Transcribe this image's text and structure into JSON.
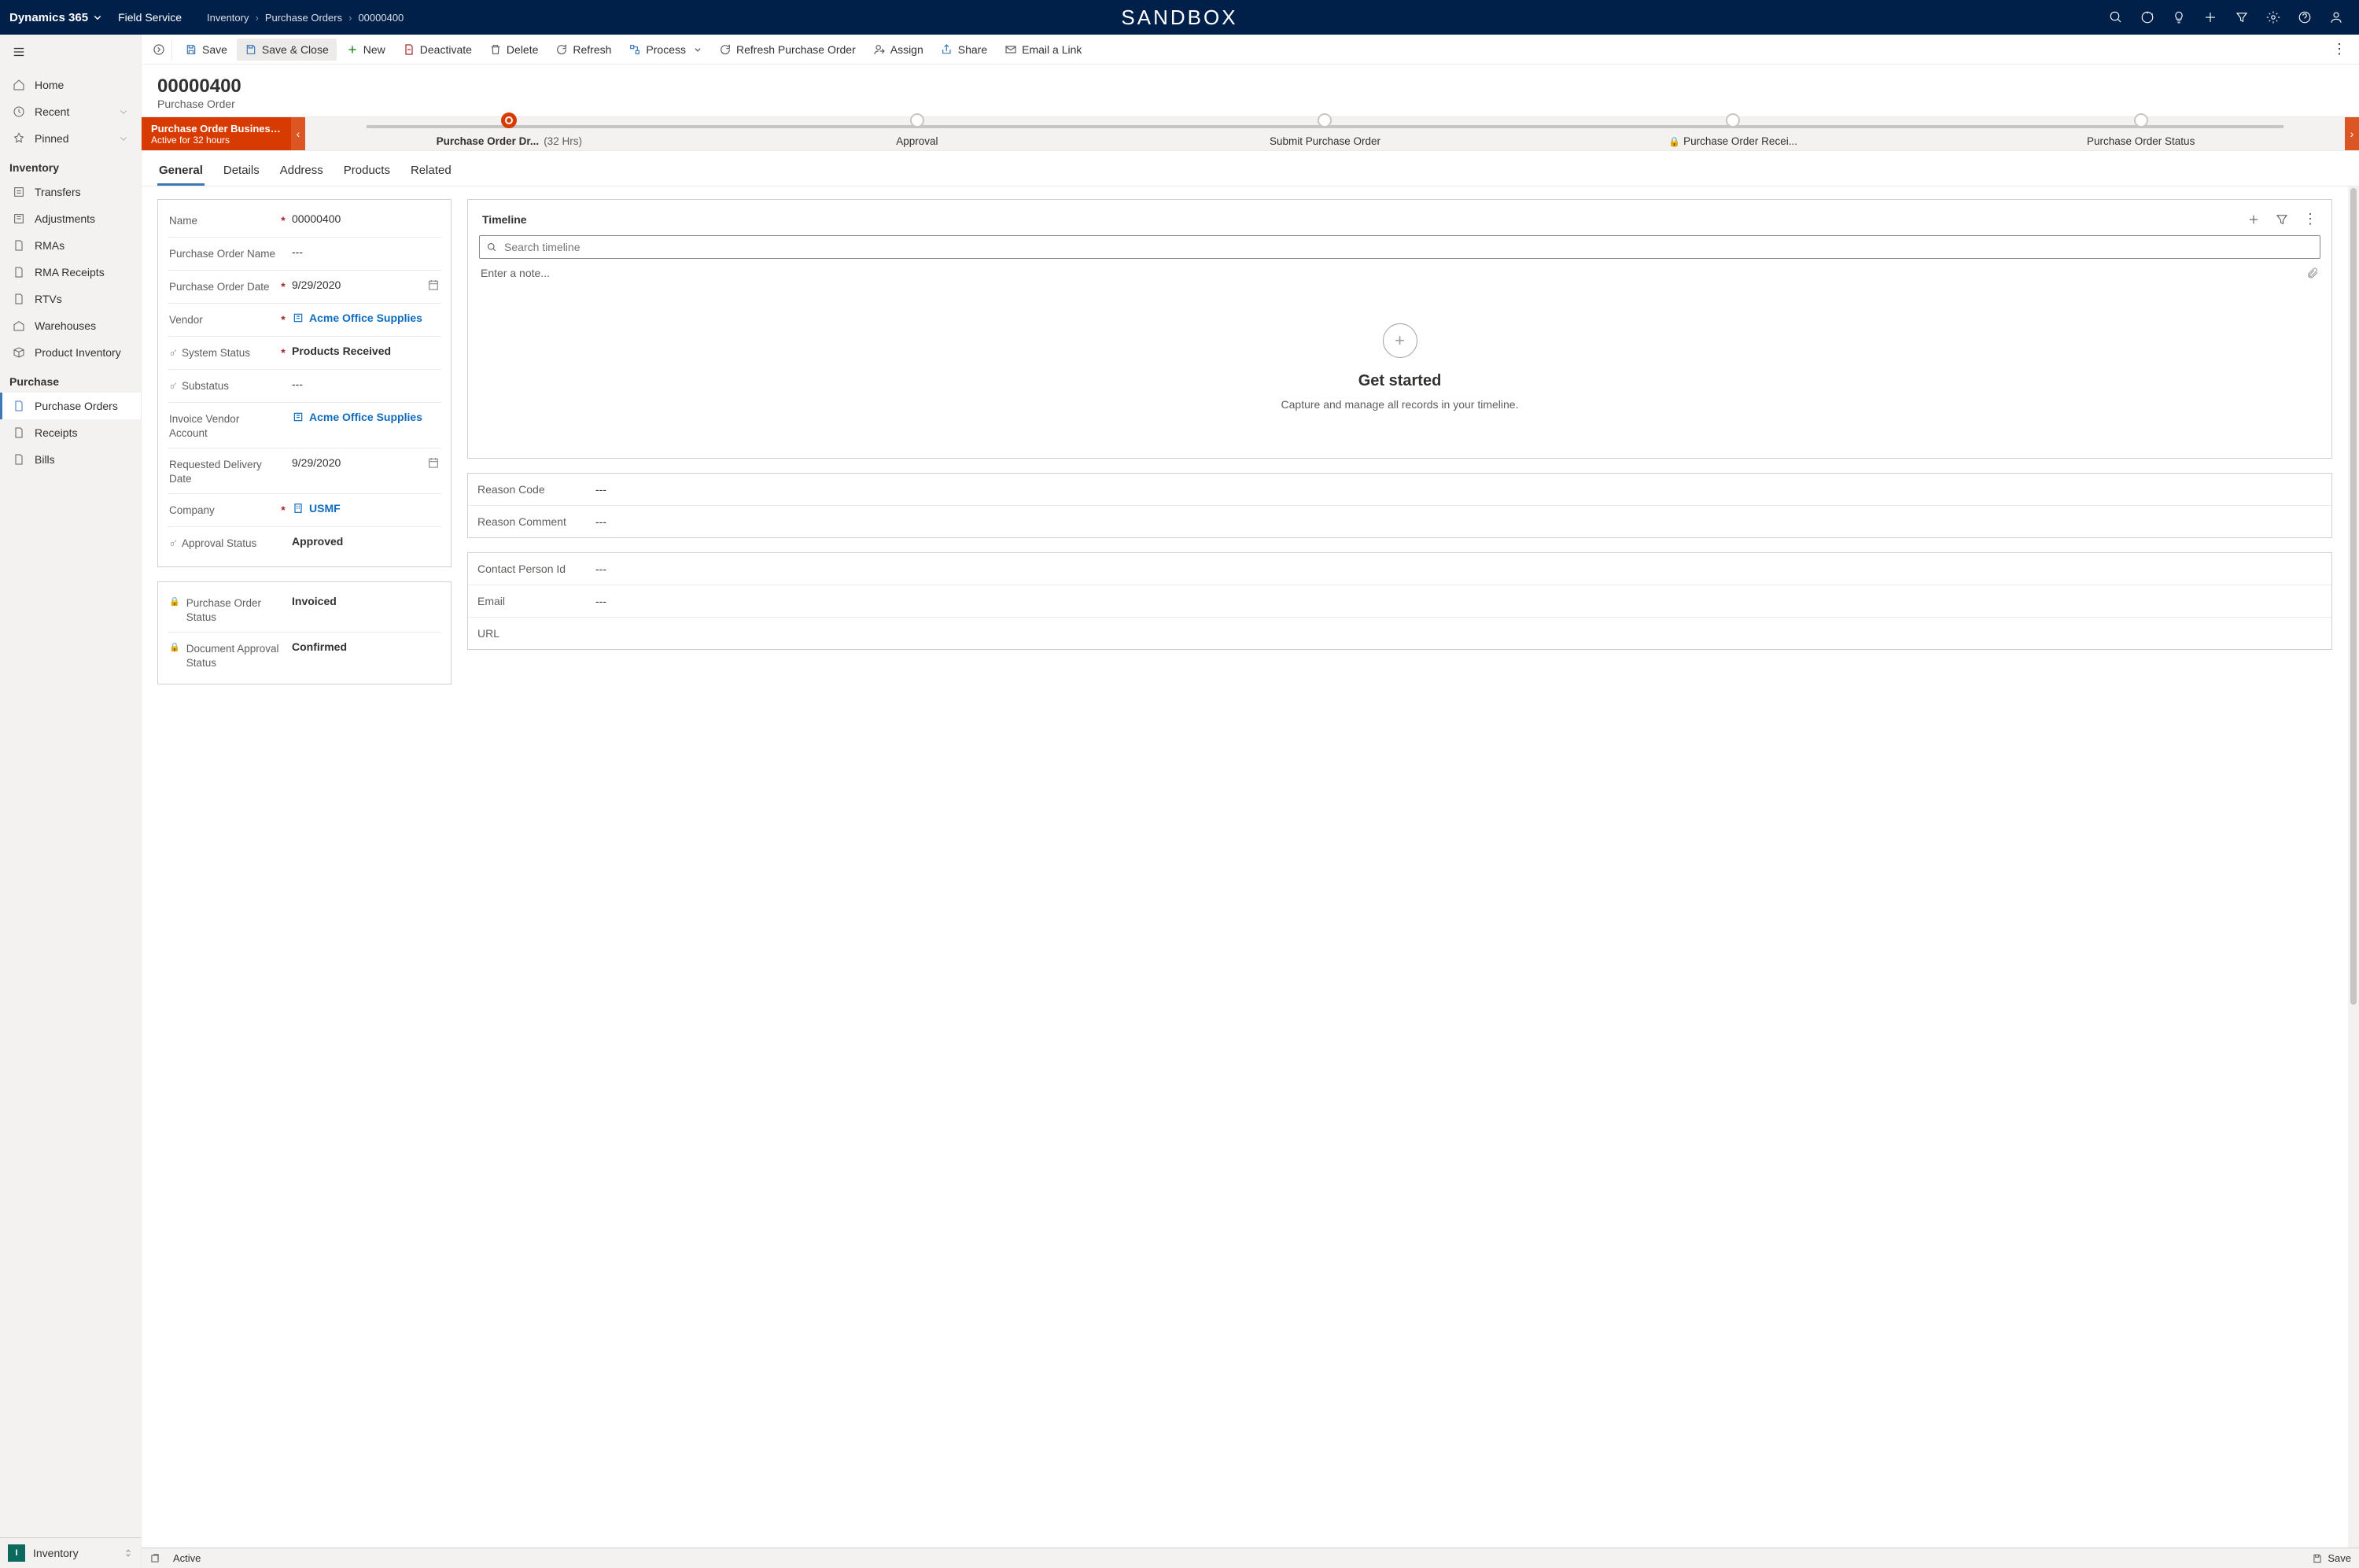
{
  "topbar": {
    "app_name": "Dynamics 365",
    "app_area": "Field Service",
    "breadcrumb": [
      "Inventory",
      "Purchase Orders",
      "00000400"
    ],
    "env_label": "SANDBOX"
  },
  "sidebar": {
    "nav_home": "Home",
    "nav_recent": "Recent",
    "nav_pinned": "Pinned",
    "section_inventory": "Inventory",
    "nav_transfers": "Transfers",
    "nav_adjustments": "Adjustments",
    "nav_rmas": "RMAs",
    "nav_rma_receipts": "RMA Receipts",
    "nav_rtvs": "RTVs",
    "nav_warehouses": "Warehouses",
    "nav_product_inventory": "Product Inventory",
    "section_purchase": "Purchase",
    "nav_purchase_orders": "Purchase Orders",
    "nav_receipts": "Receipts",
    "nav_bills": "Bills",
    "footer_badge": "I",
    "footer_label": "Inventory"
  },
  "commands": {
    "save": "Save",
    "save_close": "Save & Close",
    "new": "New",
    "deactivate": "Deactivate",
    "delete": "Delete",
    "refresh": "Refresh",
    "process": "Process",
    "refresh_po": "Refresh Purchase Order",
    "assign": "Assign",
    "share": "Share",
    "email_link": "Email a Link"
  },
  "record": {
    "title": "00000400",
    "subtitle": "Purchase Order"
  },
  "bpf": {
    "name": "Purchase Order Business ...",
    "duration": "Active for 32 hours",
    "stages": [
      {
        "label": "Purchase Order Dr...",
        "dur": "(32 Hrs)"
      },
      {
        "label": "Approval"
      },
      {
        "label": "Submit Purchase Order"
      },
      {
        "label": "Purchase Order Recei...",
        "locked": true
      },
      {
        "label": "Purchase Order Status"
      }
    ]
  },
  "tabs": [
    "General",
    "Details",
    "Address",
    "Products",
    "Related"
  ],
  "form": {
    "name_lbl": "Name",
    "name_val": "00000400",
    "po_name_lbl": "Purchase Order Name",
    "po_name_val": "---",
    "po_date_lbl": "Purchase Order Date",
    "po_date_val": "9/29/2020",
    "vendor_lbl": "Vendor",
    "vendor_val": "Acme Office Supplies",
    "sysstatus_lbl": "System Status",
    "sysstatus_val": "Products Received",
    "substatus_lbl": "Substatus",
    "substatus_val": "---",
    "inv_vendor_lbl": "Invoice Vendor Account",
    "inv_vendor_val": "Acme Office Supplies",
    "reqdate_lbl": "Requested Delivery Date",
    "reqdate_val": "9/29/2020",
    "company_lbl": "Company",
    "company_val": "USMF",
    "appr_lbl": "Approval Status",
    "appr_val": "Approved",
    "po_status_lbl": "Purchase Order Status",
    "po_status_val": "Invoiced",
    "doc_appr_lbl": "Document Approval Status",
    "doc_appr_val": "Confirmed"
  },
  "timeline": {
    "title": "Timeline",
    "search_ph": "Search timeline",
    "note_ph": "Enter a note...",
    "empty_hdr": "Get started",
    "empty_msg": "Capture and manage all records in your timeline."
  },
  "side_panel": {
    "reason_code_lbl": "Reason Code",
    "reason_code_val": "---",
    "reason_comment_lbl": "Reason Comment",
    "reason_comment_val": "---",
    "contact_lbl": "Contact Person Id",
    "contact_val": "---",
    "email_lbl": "Email",
    "email_val": "---",
    "url_lbl": "URL"
  },
  "status": {
    "state": "Active",
    "save": "Save"
  }
}
